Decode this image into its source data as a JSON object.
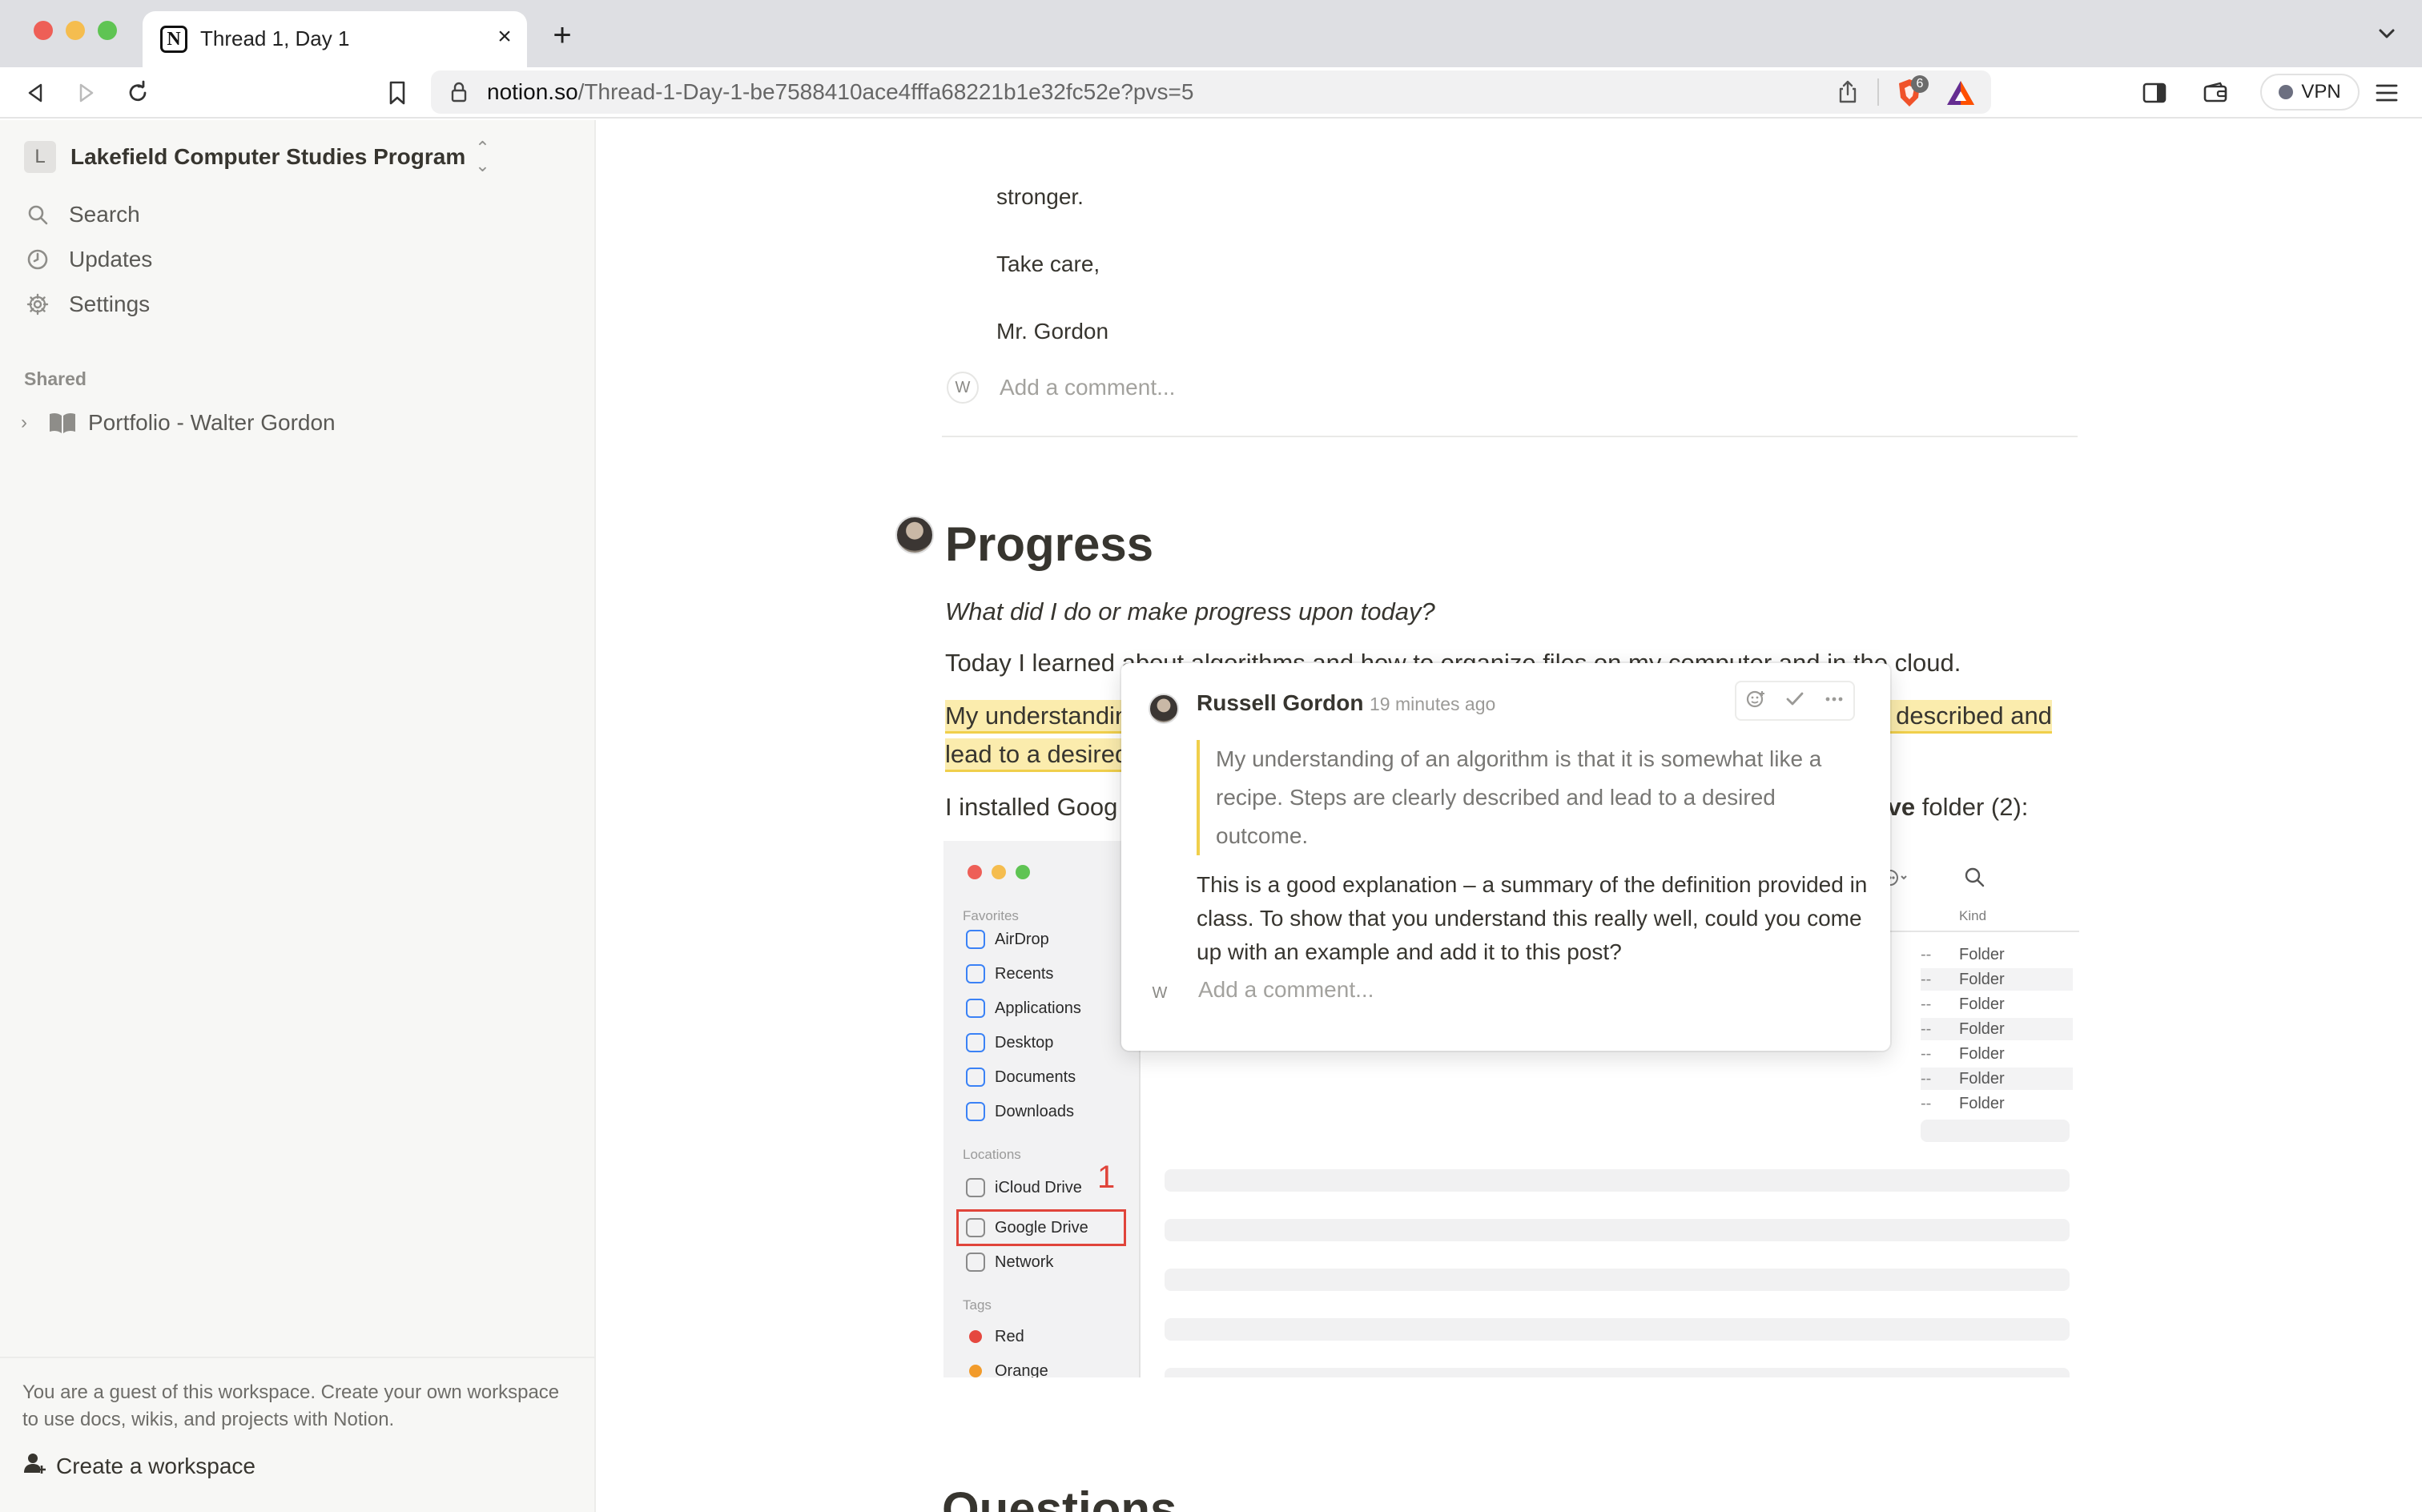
{
  "browser": {
    "tab_title": "Thread 1, Day 1",
    "url_host": "notion.so",
    "url_path": "/Thread-1-Day-1-be7588410ace4fffa68221b1e32fc52e?pvs=5",
    "shield_badge": "6",
    "vpn_label": "VPN"
  },
  "sidebar": {
    "workspace_initial": "L",
    "workspace_name": "Lakefield Computer Studies Program",
    "nav": [
      {
        "label": "Search",
        "icon": "search-icon"
      },
      {
        "label": "Updates",
        "icon": "clock-icon"
      },
      {
        "label": "Settings",
        "icon": "gear-icon"
      }
    ],
    "shared_label": "Shared",
    "shared_items": [
      {
        "label": "Portfolio - Walter Gordon",
        "icon": "book-icon"
      }
    ],
    "guest_notice": "You are a guest of this workspace. Create your own workspace to use docs, wikis, and projects with Notion.",
    "create_workspace": "Create a workspace"
  },
  "page": {
    "letter_lines": [
      "stronger.",
      "Take care,",
      "Mr. Gordon"
    ],
    "comment_avatar_initial": "W",
    "add_comment_placeholder": "Add a comment...",
    "heading": "Progress",
    "prompt": "What did I do or make progress upon today?",
    "para1": "Today I learned about algorithms and how to organize files on my computer and in the cloud.",
    "highlighted": "My understanding of an algorithm is that it is somewhat like a recipe. Steps are clearly described and lead to a desired outcome.",
    "para3_start": "I installed Goog",
    "para3_end_bold": "ive",
    "para3_end": " folder (2):",
    "next_heading": "Questions"
  },
  "finder": {
    "favorites_label": "Favorites",
    "favorites": [
      "AirDrop",
      "Recents",
      "Applications",
      "Desktop",
      "Documents",
      "Downloads"
    ],
    "locations_label": "Locations",
    "locations": [
      "iCloud Drive",
      "Google Drive",
      "Network"
    ],
    "step_number": "1",
    "tags_label": "Tags",
    "tags": [
      {
        "label": "Red",
        "color": "#e5483f"
      },
      {
        "label": "Orange",
        "color": "#f29b2b"
      }
    ],
    "kind_header": "Kind",
    "rows": [
      {
        "size": "--",
        "kind": "Folder"
      },
      {
        "size": "--",
        "kind": "Folder"
      },
      {
        "size": "--",
        "kind": "Folder"
      },
      {
        "size": "--",
        "kind": "Folder"
      },
      {
        "size": "--",
        "kind": "Folder"
      },
      {
        "size": "--",
        "kind": "Folder"
      },
      {
        "size": "--",
        "kind": "Folder"
      }
    ]
  },
  "comment": {
    "author": "Russell Gordon",
    "time": "19 minutes ago",
    "quote": "My understanding of an algorithm is that it is somewhat like a recipe. Steps are clearly described and lead to a desired outcome.",
    "body": "This is a good explanation – a summary of the definition provided in class. To show that you understand this really well, could you come up with an example and add it to this post?",
    "reply_avatar_initial": "W",
    "reply_placeholder": "Add a comment..."
  },
  "colors": {
    "highlight": "#fbecad",
    "highlight_underline": "#f0cf4b",
    "annotation_red": "#e0443a",
    "sidebar_bg": "#f7f7f5"
  }
}
